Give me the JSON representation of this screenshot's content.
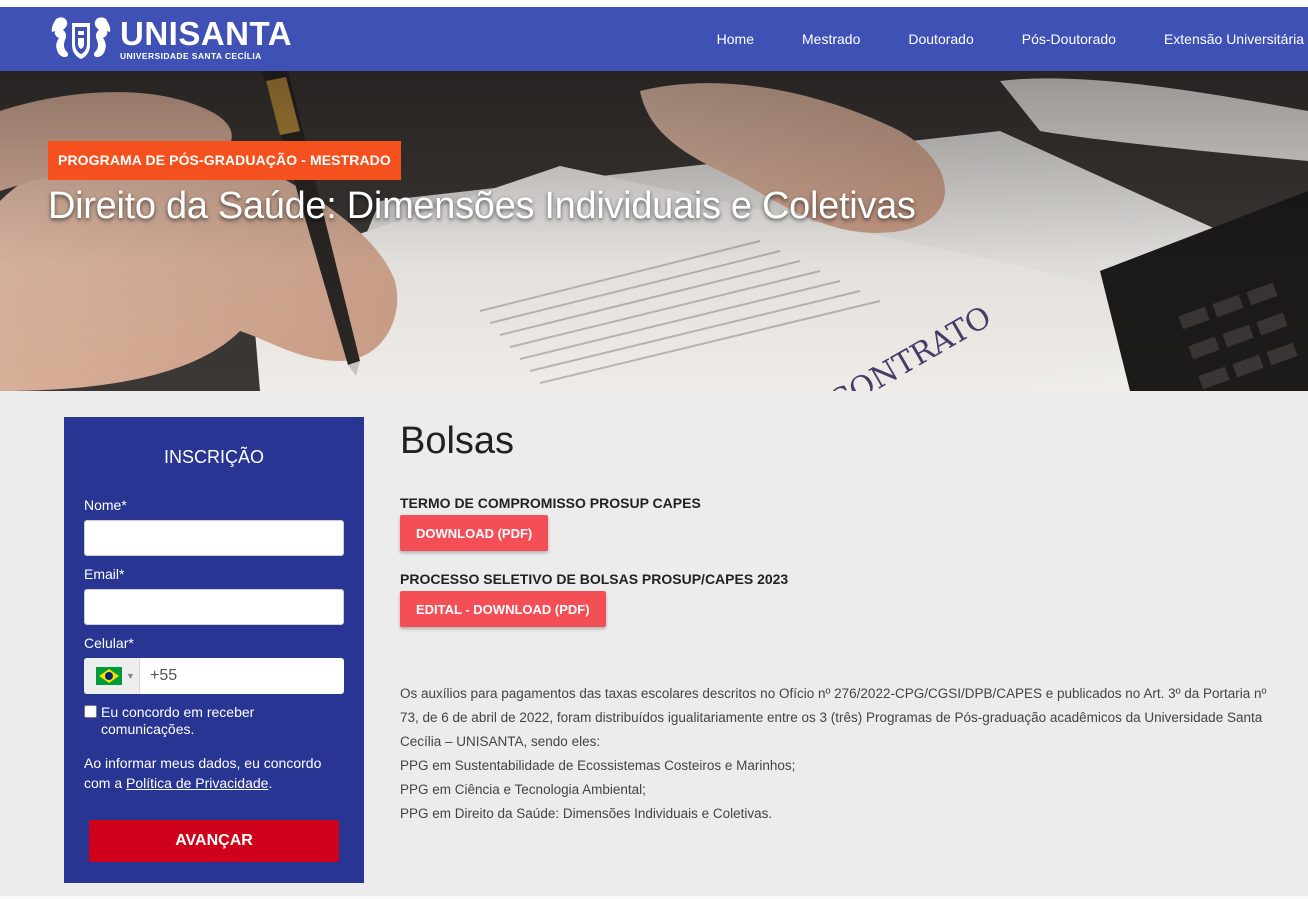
{
  "brand": {
    "name": "UNISANTA",
    "subtitle": "UNIVERSIDADE SANTA CECÍLIA"
  },
  "nav": {
    "items": [
      {
        "label": "Home"
      },
      {
        "label": "Mestrado"
      },
      {
        "label": "Doutorado"
      },
      {
        "label": "Pós-Doutorado"
      },
      {
        "label": "Extensão Universitária"
      }
    ]
  },
  "hero": {
    "tag": "PROGRAMA DE PÓS-GRADUAÇÃO - MESTRADO",
    "title": "Direito da Saúde: Dimensões Individuais e Coletivas"
  },
  "form": {
    "title": "INSCRIÇÃO",
    "name_label": "Nome*",
    "name_value": "",
    "email_label": "Email*",
    "email_value": "",
    "phone_label": "Celular*",
    "phone_country_icon": "brazil-flag-icon",
    "phone_code": "+55",
    "consent_label": "Eu concordo em receber comunicações.",
    "privacy_text": "Ao informar meus dados, eu concordo com a",
    "privacy_link": "Política de Privacidade",
    "privacy_end": ".",
    "submit_label": "AVANÇAR"
  },
  "content": {
    "heading": "Bolsas",
    "sections": [
      {
        "title": "TERMO DE COMPROMISSO PROSUP CAPES",
        "button": "DOWNLOAD (PDF)"
      },
      {
        "title": "PROCESSO SELETIVO DE BOLSAS PROSUP/CAPES 2023",
        "button": "EDITAL - DOWNLOAD (PDF)"
      }
    ],
    "paragraph_lines": [
      "Os auxílios para pagamentos das taxas escolares descritos no Ofício nº 276/2022-CPG/CGSI/DPB/CAPES e publicados no Art. 3º da Portaria nº",
      "73, de 6 de abril de 2022, foram distribuídos igualitariamente entre os 3 (três) Programas de Pós-graduação acadêmicos da Universidade Santa",
      "Cecília – UNISANTA, sendo eles:",
      "PPG em Sustentabilidade de Ecossistemas Costeiros e Marinhos;",
      "PPG em Ciência e Tecnologia Ambiental;",
      "PPG em Direito da Saúde: Dimensões Individuais e Coletivas."
    ]
  },
  "colors": {
    "header": "#3f51b5",
    "form_bg": "#283593",
    "tag_orange": "#f4511e",
    "button_red": "#f44e57",
    "submit_red": "#d0021b"
  }
}
